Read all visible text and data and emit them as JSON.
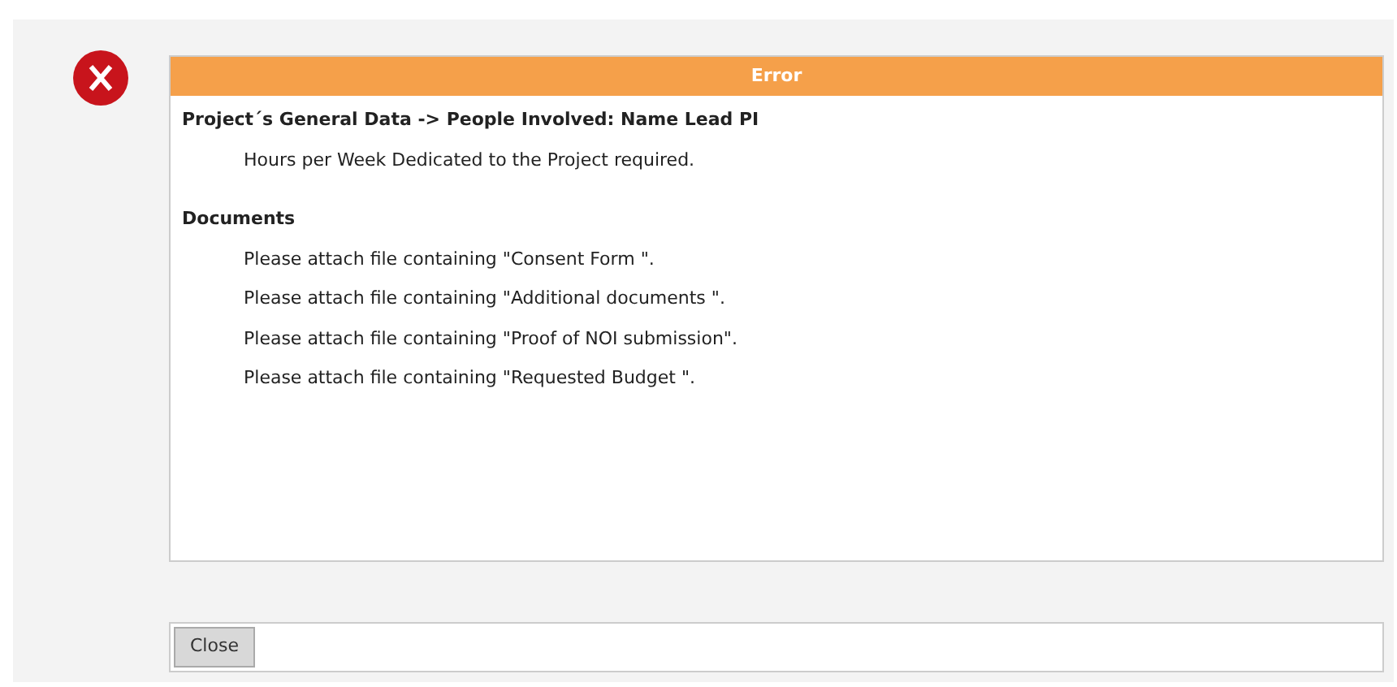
{
  "dialog": {
    "title": "Error",
    "sections": [
      {
        "heading": "Project´s General Data -> People Involved: Name Lead PI",
        "messages": [
          "Hours per Week Dedicated to the Project required."
        ]
      },
      {
        "heading": "Documents",
        "messages": [
          "Please attach file containing \"Consent Form \".",
          "Please attach file containing \"Additional documents \".",
          "Please attach file containing \"Proof of NOI submission\".",
          "Please attach file containing \"Requested Budget \"."
        ]
      }
    ],
    "buttons": [
      "Close"
    ]
  }
}
